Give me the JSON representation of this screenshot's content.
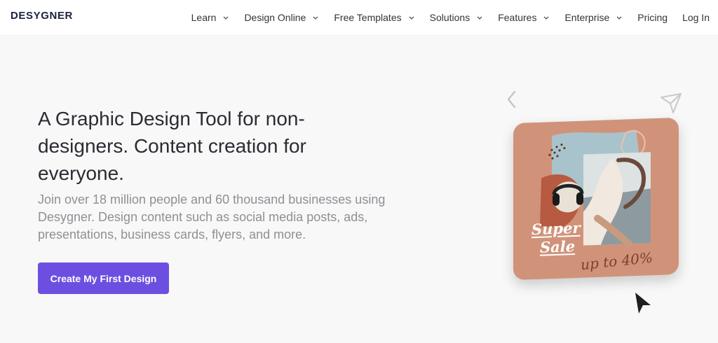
{
  "brand": {
    "name": "DESYGNER"
  },
  "nav": {
    "items": [
      {
        "label": "Learn",
        "has_dropdown": true
      },
      {
        "label": "Design Online",
        "has_dropdown": true
      },
      {
        "label": "Free Templates",
        "has_dropdown": true
      },
      {
        "label": "Solutions",
        "has_dropdown": true
      },
      {
        "label": "Features",
        "has_dropdown": true
      },
      {
        "label": "Enterprise",
        "has_dropdown": true
      },
      {
        "label": "Pricing",
        "has_dropdown": false
      },
      {
        "label": "Log In",
        "has_dropdown": false
      }
    ]
  },
  "hero": {
    "title": "A Graphic Design Tool for non-designers. Content creation for everyone.",
    "subtitle": "Join over 18 million people and 60 thousand businesses using Desygner. Design content such as social media posts, ads, presentations, business cards, flyers, and more.",
    "cta_label": "Create My First Design"
  },
  "showcase": {
    "promo_line1": "Super",
    "promo_line2": "Sale",
    "promo_line3": "up to 40%",
    "icons": [
      "chevron-left-icon",
      "send-icon",
      "cursor-icon"
    ]
  },
  "colors": {
    "accent": "#6c4fe0",
    "card_bg": "#d0937a",
    "card_shape": "#a9c3cc",
    "brand_text": "#1c2340"
  }
}
